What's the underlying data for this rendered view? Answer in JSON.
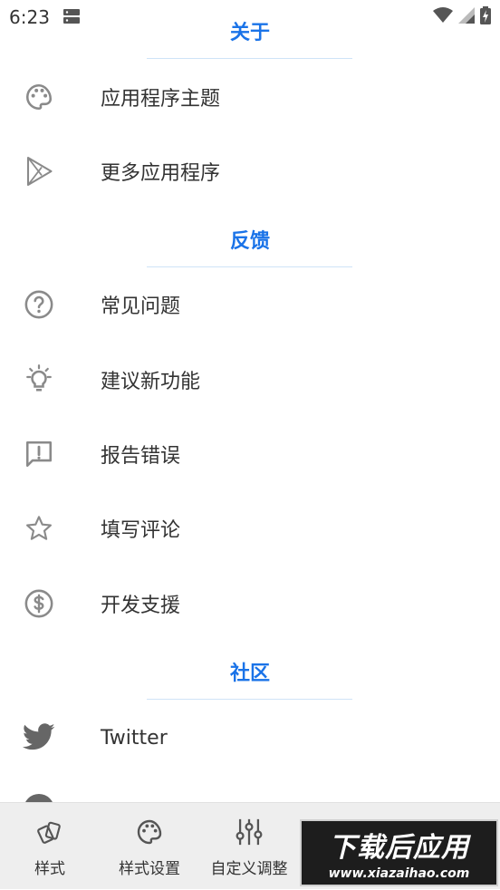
{
  "status_bar": {
    "time": "6:23",
    "icons": [
      "sd-card-icon",
      "wifi-icon",
      "signal-icon",
      "battery-charging-icon"
    ]
  },
  "sections": {
    "about": {
      "title": "关于",
      "items": [
        {
          "label": "应用程序主题",
          "icon": "palette-icon"
        },
        {
          "label": "更多应用程序",
          "icon": "play-store-icon"
        }
      ]
    },
    "feedback": {
      "title": "反馈",
      "items": [
        {
          "label": "常见问题",
          "icon": "help-circle-icon"
        },
        {
          "label": "建议新功能",
          "icon": "lightbulb-icon"
        },
        {
          "label": "报告错误",
          "icon": "feedback-icon"
        },
        {
          "label": "填写评论",
          "icon": "star-icon"
        },
        {
          "label": "开发支援",
          "icon": "dollar-circle-icon"
        }
      ]
    },
    "community": {
      "title": "社区",
      "items": [
        {
          "label": "Twitter",
          "icon": "twitter-icon"
        }
      ]
    }
  },
  "bottom_nav": {
    "items": [
      {
        "label": "样式",
        "icon": "cards-icon"
      },
      {
        "label": "样式设置",
        "icon": "palette-icon"
      },
      {
        "label": "自定义调整",
        "icon": "sliders-icon"
      }
    ]
  },
  "watermark": {
    "title": "下载后应用",
    "url": "www.xiazaihao.com"
  },
  "colors": {
    "accent": "#1a73e8",
    "divider": "#cfe3f7",
    "icon": "#8a8a8a",
    "text": "#333333",
    "nav_background": "#eeeeee",
    "twitter_icon": "#666666"
  }
}
